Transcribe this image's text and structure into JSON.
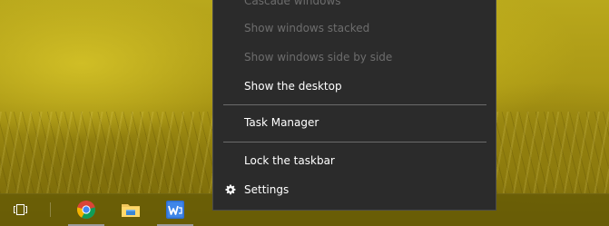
{
  "context_menu": {
    "items": [
      {
        "label": "Cascade windows",
        "enabled": false
      },
      {
        "label": "Show windows stacked",
        "enabled": false
      },
      {
        "label": "Show windows side by side",
        "enabled": false
      },
      {
        "label": "Show the desktop",
        "enabled": true
      },
      {
        "label": "Task Manager",
        "enabled": true
      },
      {
        "label": "Lock the taskbar",
        "enabled": true
      },
      {
        "label": "Settings",
        "enabled": true,
        "icon": "gear-icon"
      }
    ]
  },
  "taskbar": {
    "buttons": [
      {
        "name": "task-view",
        "icon": "task-view-icon"
      },
      {
        "name": "chrome",
        "icon": "chrome-icon"
      },
      {
        "name": "file-explorer",
        "icon": "folder-icon"
      },
      {
        "name": "wps-writer",
        "icon": "wps-writer-icon"
      }
    ]
  },
  "colors": {
    "menu_bg": "#2b2b2b",
    "menu_text": "#ffffff",
    "menu_text_disabled": "#6d6d6d",
    "taskbar_bg": "#675c06",
    "pinned_underline": "#9a9a9a"
  }
}
